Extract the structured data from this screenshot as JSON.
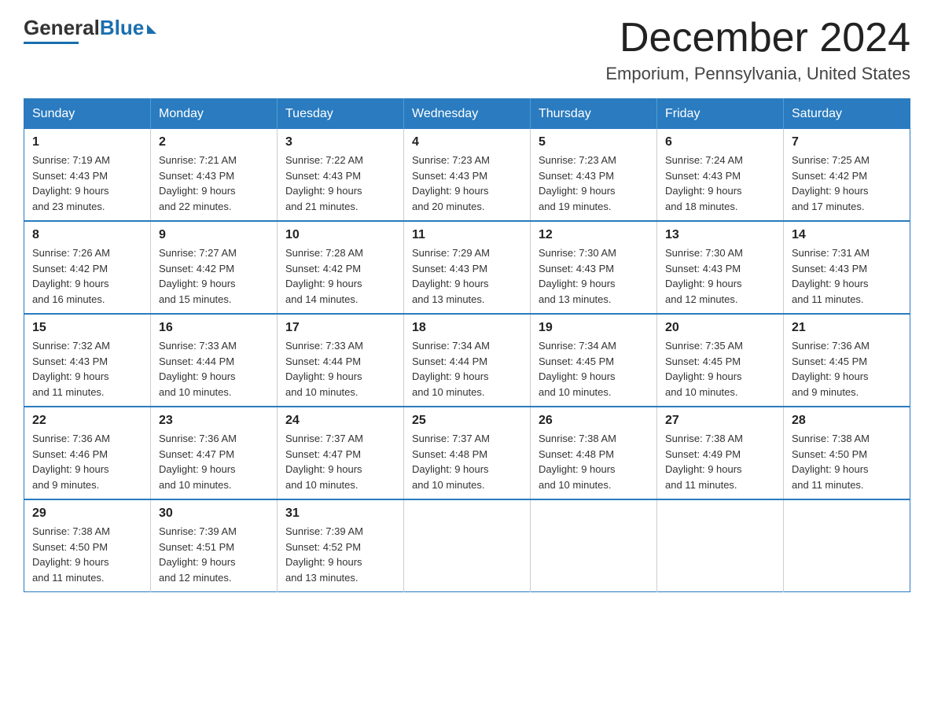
{
  "logo": {
    "general": "General",
    "blue": "Blue"
  },
  "title": "December 2024",
  "subtitle": "Emporium, Pennsylvania, United States",
  "days_of_week": [
    "Sunday",
    "Monday",
    "Tuesday",
    "Wednesday",
    "Thursday",
    "Friday",
    "Saturday"
  ],
  "weeks": [
    [
      {
        "day": "1",
        "sunrise": "7:19 AM",
        "sunset": "4:43 PM",
        "daylight": "9 hours and 23 minutes."
      },
      {
        "day": "2",
        "sunrise": "7:21 AM",
        "sunset": "4:43 PM",
        "daylight": "9 hours and 22 minutes."
      },
      {
        "day": "3",
        "sunrise": "7:22 AM",
        "sunset": "4:43 PM",
        "daylight": "9 hours and 21 minutes."
      },
      {
        "day": "4",
        "sunrise": "7:23 AM",
        "sunset": "4:43 PM",
        "daylight": "9 hours and 20 minutes."
      },
      {
        "day": "5",
        "sunrise": "7:23 AM",
        "sunset": "4:43 PM",
        "daylight": "9 hours and 19 minutes."
      },
      {
        "day": "6",
        "sunrise": "7:24 AM",
        "sunset": "4:43 PM",
        "daylight": "9 hours and 18 minutes."
      },
      {
        "day": "7",
        "sunrise": "7:25 AM",
        "sunset": "4:42 PM",
        "daylight": "9 hours and 17 minutes."
      }
    ],
    [
      {
        "day": "8",
        "sunrise": "7:26 AM",
        "sunset": "4:42 PM",
        "daylight": "9 hours and 16 minutes."
      },
      {
        "day": "9",
        "sunrise": "7:27 AM",
        "sunset": "4:42 PM",
        "daylight": "9 hours and 15 minutes."
      },
      {
        "day": "10",
        "sunrise": "7:28 AM",
        "sunset": "4:42 PM",
        "daylight": "9 hours and 14 minutes."
      },
      {
        "day": "11",
        "sunrise": "7:29 AM",
        "sunset": "4:43 PM",
        "daylight": "9 hours and 13 minutes."
      },
      {
        "day": "12",
        "sunrise": "7:30 AM",
        "sunset": "4:43 PM",
        "daylight": "9 hours and 13 minutes."
      },
      {
        "day": "13",
        "sunrise": "7:30 AM",
        "sunset": "4:43 PM",
        "daylight": "9 hours and 12 minutes."
      },
      {
        "day": "14",
        "sunrise": "7:31 AM",
        "sunset": "4:43 PM",
        "daylight": "9 hours and 11 minutes."
      }
    ],
    [
      {
        "day": "15",
        "sunrise": "7:32 AM",
        "sunset": "4:43 PM",
        "daylight": "9 hours and 11 minutes."
      },
      {
        "day": "16",
        "sunrise": "7:33 AM",
        "sunset": "4:44 PM",
        "daylight": "9 hours and 10 minutes."
      },
      {
        "day": "17",
        "sunrise": "7:33 AM",
        "sunset": "4:44 PM",
        "daylight": "9 hours and 10 minutes."
      },
      {
        "day": "18",
        "sunrise": "7:34 AM",
        "sunset": "4:44 PM",
        "daylight": "9 hours and 10 minutes."
      },
      {
        "day": "19",
        "sunrise": "7:34 AM",
        "sunset": "4:45 PM",
        "daylight": "9 hours and 10 minutes."
      },
      {
        "day": "20",
        "sunrise": "7:35 AM",
        "sunset": "4:45 PM",
        "daylight": "9 hours and 10 minutes."
      },
      {
        "day": "21",
        "sunrise": "7:36 AM",
        "sunset": "4:45 PM",
        "daylight": "9 hours and 9 minutes."
      }
    ],
    [
      {
        "day": "22",
        "sunrise": "7:36 AM",
        "sunset": "4:46 PM",
        "daylight": "9 hours and 9 minutes."
      },
      {
        "day": "23",
        "sunrise": "7:36 AM",
        "sunset": "4:47 PM",
        "daylight": "9 hours and 10 minutes."
      },
      {
        "day": "24",
        "sunrise": "7:37 AM",
        "sunset": "4:47 PM",
        "daylight": "9 hours and 10 minutes."
      },
      {
        "day": "25",
        "sunrise": "7:37 AM",
        "sunset": "4:48 PM",
        "daylight": "9 hours and 10 minutes."
      },
      {
        "day": "26",
        "sunrise": "7:38 AM",
        "sunset": "4:48 PM",
        "daylight": "9 hours and 10 minutes."
      },
      {
        "day": "27",
        "sunrise": "7:38 AM",
        "sunset": "4:49 PM",
        "daylight": "9 hours and 11 minutes."
      },
      {
        "day": "28",
        "sunrise": "7:38 AM",
        "sunset": "4:50 PM",
        "daylight": "9 hours and 11 minutes."
      }
    ],
    [
      {
        "day": "29",
        "sunrise": "7:38 AM",
        "sunset": "4:50 PM",
        "daylight": "9 hours and 11 minutes."
      },
      {
        "day": "30",
        "sunrise": "7:39 AM",
        "sunset": "4:51 PM",
        "daylight": "9 hours and 12 minutes."
      },
      {
        "day": "31",
        "sunrise": "7:39 AM",
        "sunset": "4:52 PM",
        "daylight": "9 hours and 13 minutes."
      },
      null,
      null,
      null,
      null
    ]
  ],
  "labels": {
    "sunrise": "Sunrise:",
    "sunset": "Sunset:",
    "daylight": "Daylight:"
  }
}
